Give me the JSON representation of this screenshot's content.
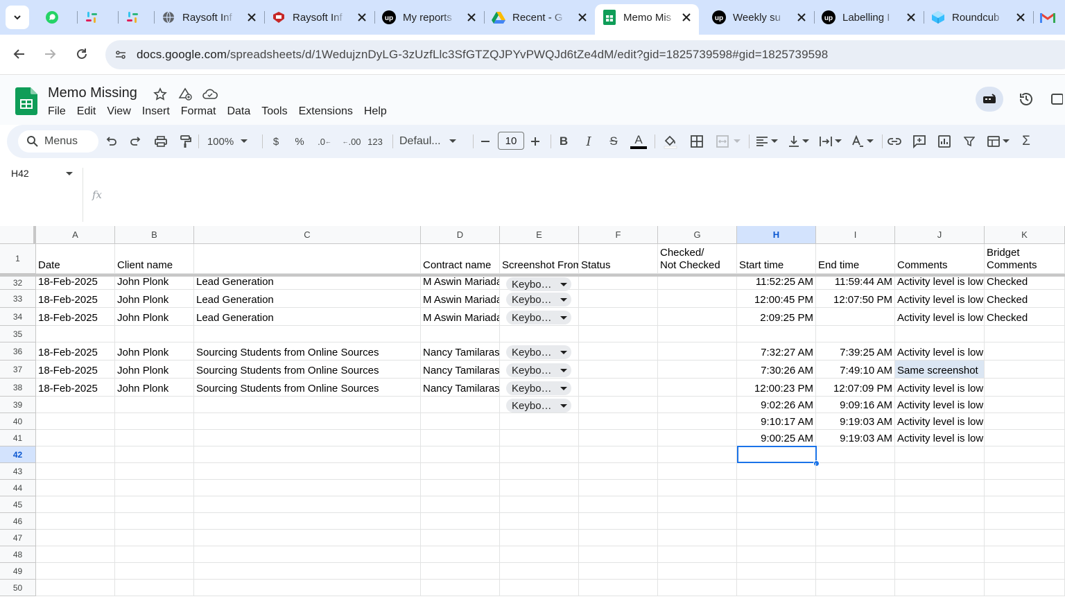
{
  "browser": {
    "tabs": [
      {
        "title": "",
        "icon": "whatsapp-icon"
      },
      {
        "title": "",
        "icon": "slack-icon"
      },
      {
        "title": "",
        "icon": "slack-icon"
      },
      {
        "title": "Raysoft Inf",
        "icon": "globe-icon"
      },
      {
        "title": "Raysoft Inf",
        "icon": "raysoft-icon"
      },
      {
        "title": "My reports",
        "icon": "upwork-icon"
      },
      {
        "title": "Recent - G",
        "icon": "google-drive-icon"
      },
      {
        "title": "Memo Mis",
        "icon": "google-sheets-icon",
        "active": true
      },
      {
        "title": "Weekly su",
        "icon": "upwork-icon"
      },
      {
        "title": "Labelling I",
        "icon": "upwork-icon"
      },
      {
        "title": "Roundcub",
        "icon": "roundcube-icon"
      },
      {
        "title": "",
        "icon": "gmail-icon"
      }
    ],
    "url_domain": "docs.google.com",
    "url_path": "/spreadsheets/d/1WedujznDyLG-3zUzfLlc3SfGTZQJPYvPWQJd6tZe4dM/edit?gid=1825739598#gid=1825739598"
  },
  "doc": {
    "title": "Memo Missing",
    "menus": [
      "File",
      "Edit",
      "View",
      "Insert",
      "Format",
      "Data",
      "Tools",
      "Extensions",
      "Help"
    ]
  },
  "toolbar": {
    "search_label": "Menus",
    "zoom": "100%",
    "currency": "$",
    "percent": "%",
    "dec_decrease": ".0",
    "dec_increase": ".00",
    "number_format": "123",
    "font": "Defaul...",
    "font_size": "10"
  },
  "formula": {
    "cell_ref": "H42",
    "fx": "fx",
    "content": ""
  },
  "sheet": {
    "columns": [
      "A",
      "B",
      "C",
      "D",
      "E",
      "F",
      "G",
      "H",
      "I",
      "J",
      "K"
    ],
    "selected_column": "H",
    "selected_row": "42",
    "header_row": {
      "num": "1",
      "cells": [
        "Date",
        "Client name",
        "",
        "Contract name",
        "Screenshot From",
        "Status",
        "Checked/\nNot Checked",
        "Start time",
        "End time",
        "Comments",
        "Bridget\nComments"
      ]
    },
    "rows": [
      {
        "num": "32",
        "cells": [
          "18-Feb-2025",
          "John Plonk",
          "Lead Generation",
          "M Aswin Mariadas",
          "Keybo…",
          "",
          "",
          "11:52:25 AM",
          "11:59:44 AM",
          "Activity level is low",
          "Checked"
        ]
      },
      {
        "num": "33",
        "cells": [
          "18-Feb-2025",
          "John Plonk",
          "Lead Generation",
          "M Aswin Mariadas",
          "Keybo…",
          "",
          "",
          "12:00:45 PM",
          "12:07:50 PM",
          "Activity level is low",
          "Checked"
        ]
      },
      {
        "num": "34",
        "cells": [
          "18-Feb-2025",
          "John Plonk",
          "Lead Generation",
          "M Aswin Mariadas",
          "Keybo…",
          "",
          "",
          "2:09:25 PM",
          "",
          "Activity level is low",
          "Checked"
        ]
      },
      {
        "num": "35",
        "cells": [
          "",
          "",
          "",
          "",
          "",
          "",
          "",
          "",
          "",
          "",
          ""
        ]
      },
      {
        "num": "36",
        "cells": [
          "18-Feb-2025",
          "John Plonk",
          "Sourcing Students from Online Sources",
          "Nancy Tamilarasi",
          "Keybo…",
          "",
          "",
          "7:32:27 AM",
          "7:39:25 AM",
          "Activity level is low",
          ""
        ]
      },
      {
        "num": "37",
        "cells": [
          "18-Feb-2025",
          "John Plonk",
          "Sourcing Students from Online Sources",
          "Nancy Tamilarasi",
          "Keybo…",
          "",
          "",
          "7:30:26 AM",
          "7:49:10 AM",
          "Same screenshot",
          ""
        ]
      },
      {
        "num": "38",
        "cells": [
          "18-Feb-2025",
          "John Plonk",
          "Sourcing Students from Online Sources",
          "Nancy Tamilarasi",
          "Keybo…",
          "",
          "",
          "12:00:23 PM",
          "12:07:09 PM",
          "Activity level is low",
          ""
        ]
      },
      {
        "num": "39",
        "cells": [
          "",
          "",
          "",
          "",
          "Keybo…",
          "",
          "",
          "9:02:26 AM",
          "9:09:16 AM",
          "Activity level is low",
          ""
        ]
      },
      {
        "num": "40",
        "cells": [
          "",
          "",
          "",
          "",
          "",
          "",
          "",
          "9:10:17 AM",
          "9:19:03 AM",
          "Activity level is low",
          ""
        ]
      },
      {
        "num": "41",
        "cells": [
          "",
          "",
          "",
          "",
          "",
          "",
          "",
          "9:00:25 AM",
          "9:19:03 AM",
          "Activity level is low",
          ""
        ]
      },
      {
        "num": "42",
        "cells": [
          "",
          "",
          "",
          "",
          "",
          "",
          "",
          "",
          "",
          "",
          ""
        ]
      },
      {
        "num": "43",
        "cells": [
          "",
          "",
          "",
          "",
          "",
          "",
          "",
          "",
          "",
          "",
          ""
        ]
      },
      {
        "num": "44",
        "cells": [
          "",
          "",
          "",
          "",
          "",
          "",
          "",
          "",
          "",
          "",
          ""
        ]
      },
      {
        "num": "45",
        "cells": [
          "",
          "",
          "",
          "",
          "",
          "",
          "",
          "",
          "",
          "",
          ""
        ]
      },
      {
        "num": "46",
        "cells": [
          "",
          "",
          "",
          "",
          "",
          "",
          "",
          "",
          "",
          "",
          ""
        ]
      },
      {
        "num": "47",
        "cells": [
          "",
          "",
          "",
          "",
          "",
          "",
          "",
          "",
          "",
          "",
          ""
        ]
      },
      {
        "num": "48",
        "cells": [
          "",
          "",
          "",
          "",
          "",
          "",
          "",
          "",
          "",
          "",
          ""
        ]
      },
      {
        "num": "49",
        "cells": [
          "",
          "",
          "",
          "",
          "",
          "",
          "",
          "",
          "",
          "",
          ""
        ]
      },
      {
        "num": "50",
        "cells": [
          "",
          "",
          "",
          "",
          "",
          "",
          "",
          "",
          "",
          "",
          ""
        ]
      }
    ]
  },
  "colors": {
    "tabbar_bg": "#d3e3fd",
    "selection": "#1a73e8",
    "sheets_green": "#0f9d58",
    "highlight_cell": "#dbe6f3"
  }
}
